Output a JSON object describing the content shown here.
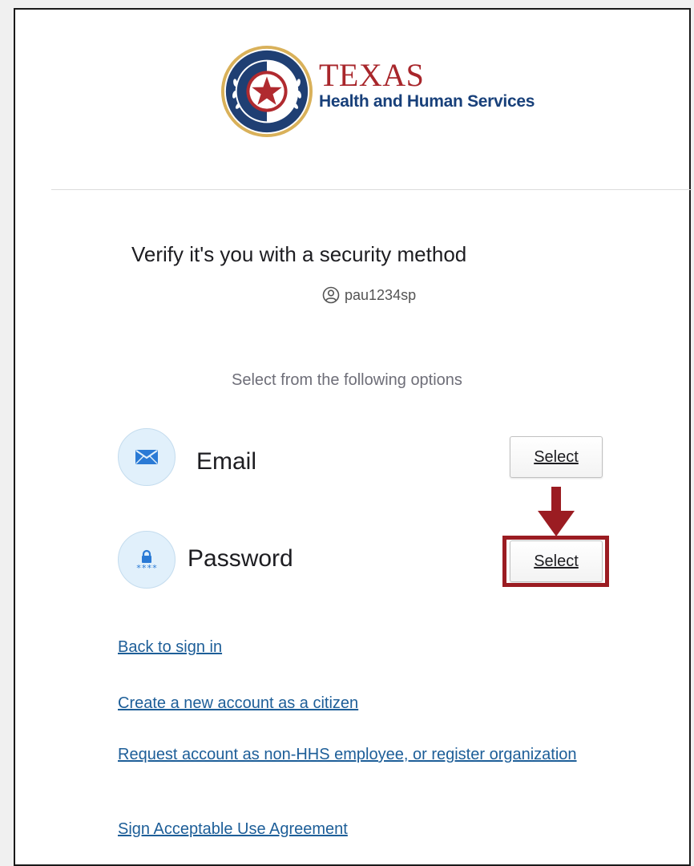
{
  "logo": {
    "title": "TEXAS",
    "subtitle": "Health and Human Services",
    "icon": "texas-seal-icon"
  },
  "heading": "Verify it's you with a security method",
  "user": {
    "icon": "user-circle-icon",
    "username": "pau1234sp"
  },
  "subheading": "Select from the following options",
  "factors": [
    {
      "label": "Email",
      "icon": "envelope-icon",
      "button_label": "Select"
    },
    {
      "label": "Password",
      "icon": "password-lock-icon",
      "button_label": "Select"
    }
  ],
  "links": {
    "back": "Back to sign in",
    "create": "Create a new account as a citizen",
    "request": "Request account as non-HHS employee, or register organization",
    "agreement": "Sign Acceptable Use Agreement"
  },
  "colors": {
    "brand_red": "#a8262b",
    "brand_blue": "#18407a",
    "link": "#1d5e98",
    "highlight": "#9b1c22"
  }
}
